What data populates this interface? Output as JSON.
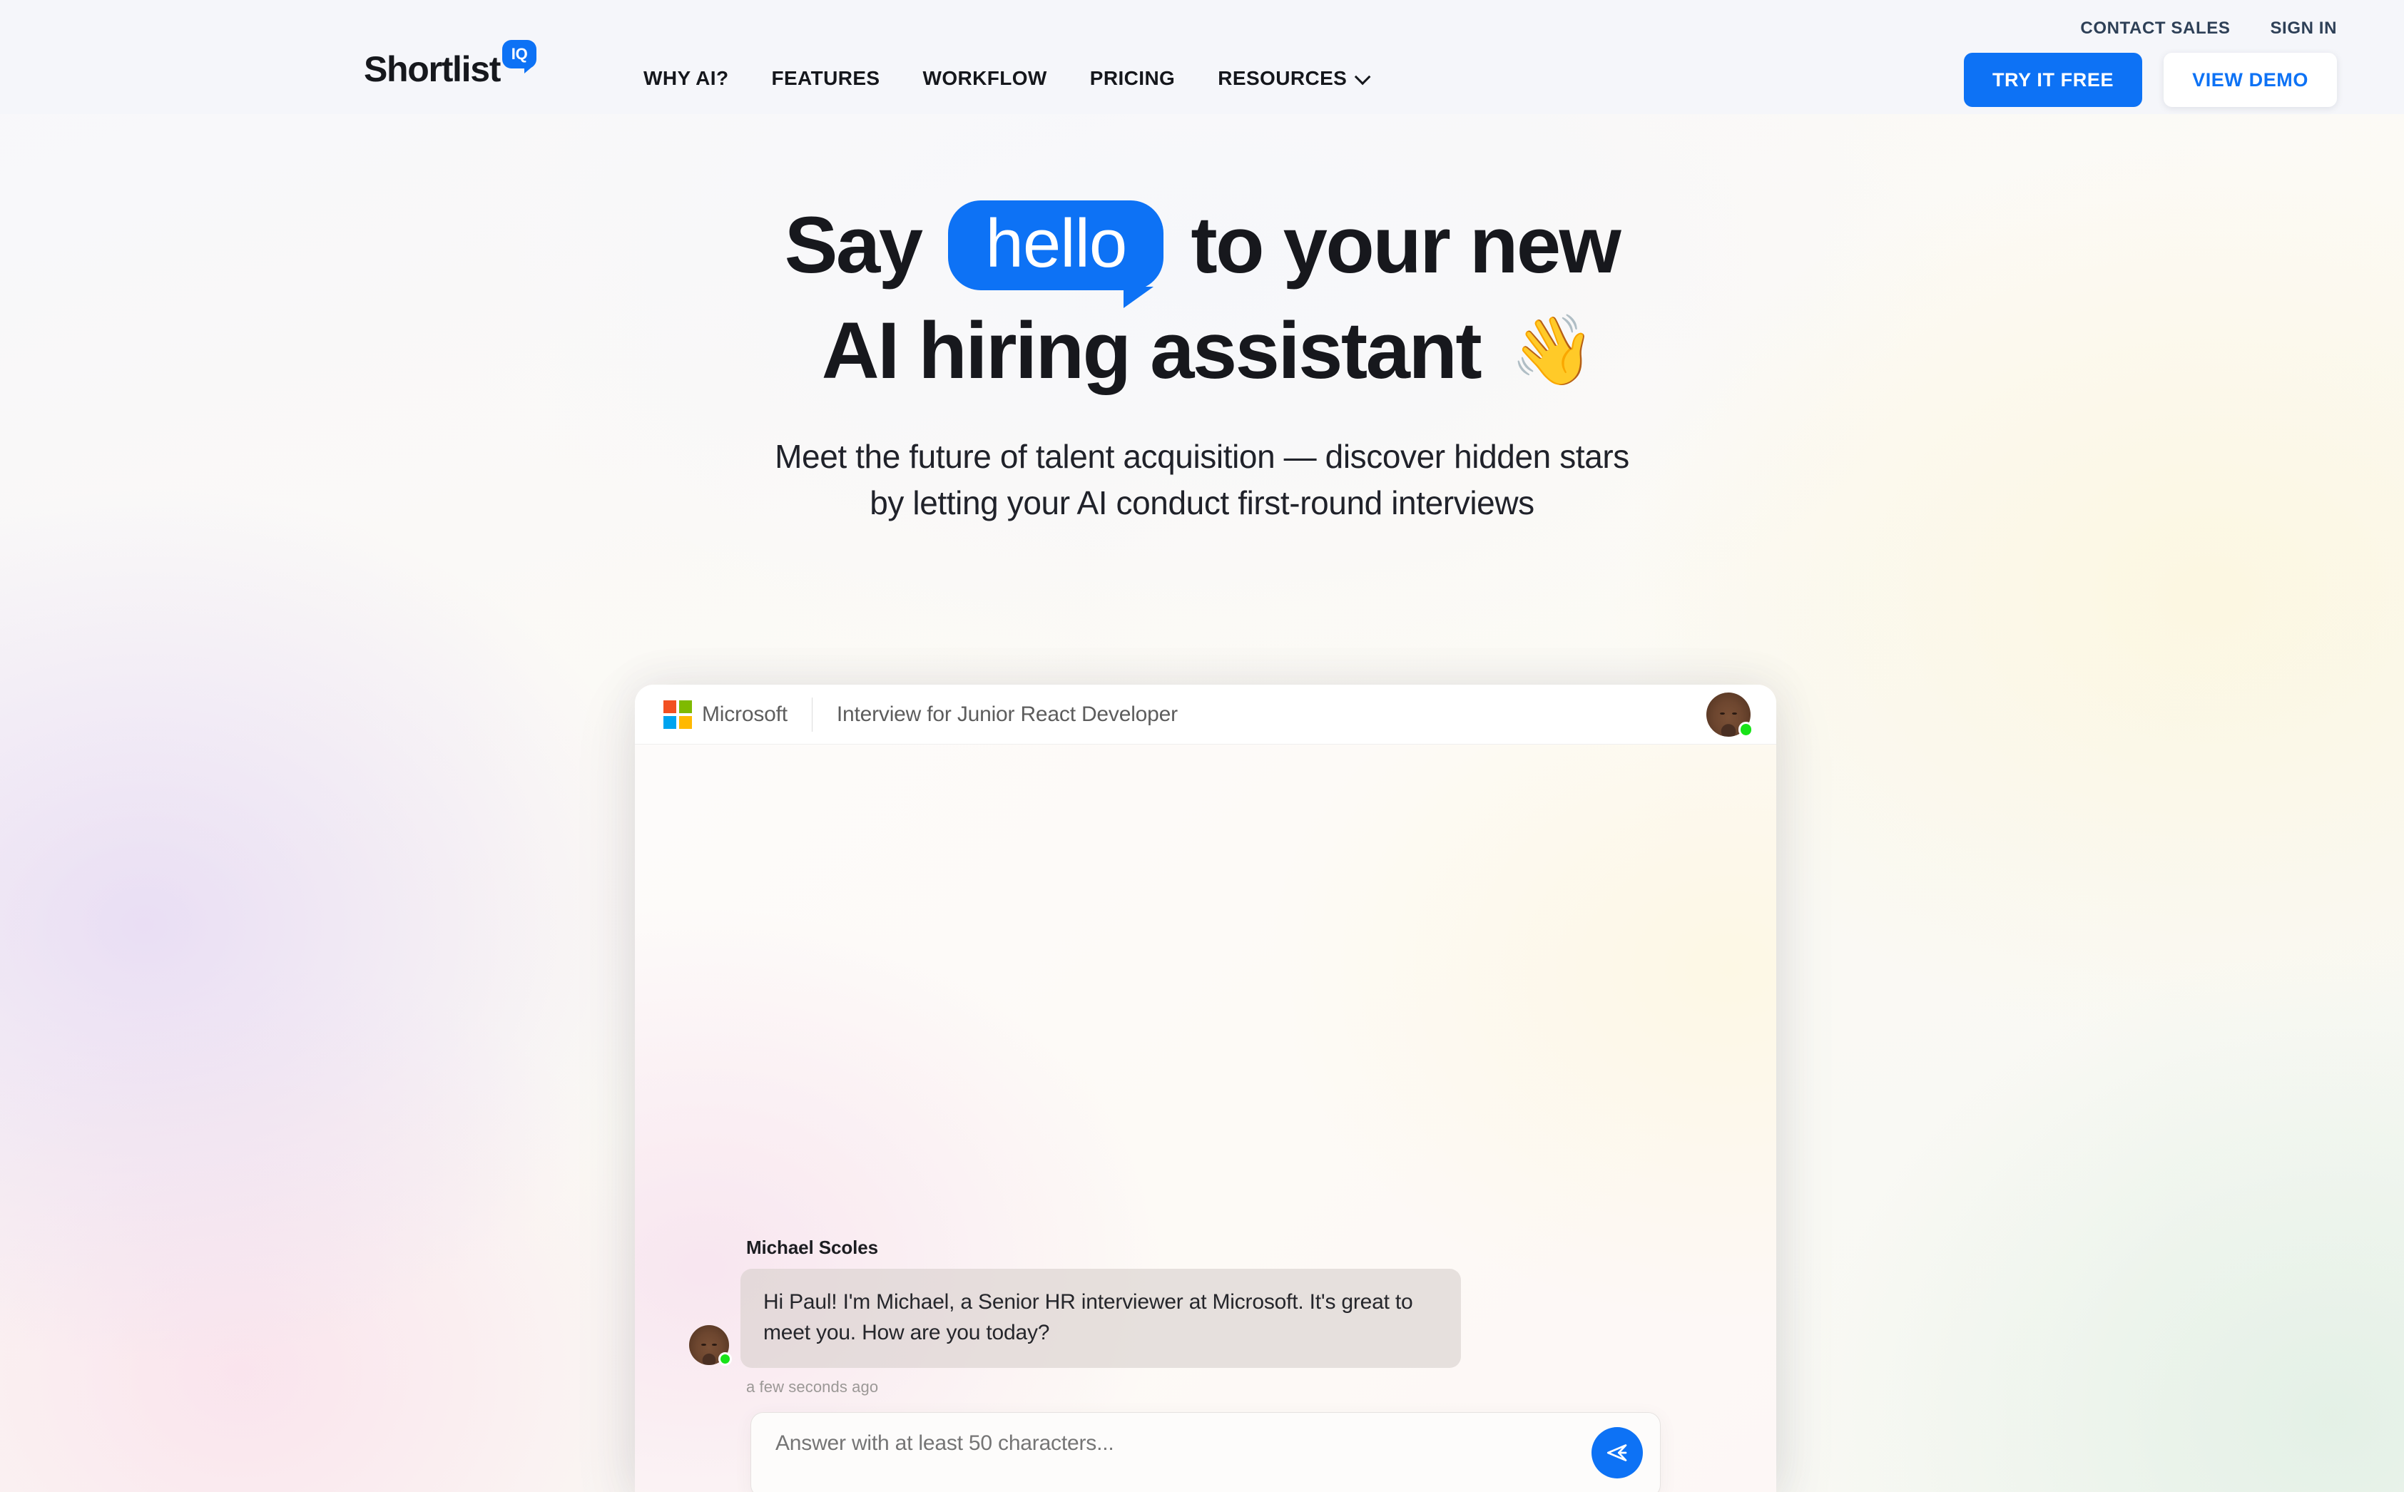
{
  "brand": {
    "name": "Shortlist",
    "badge": "IQ",
    "accent": "#0d72f5"
  },
  "nav": {
    "items": [
      {
        "label": "WHY AI?",
        "has_chevron": false
      },
      {
        "label": "FEATURES",
        "has_chevron": false
      },
      {
        "label": "WORKFLOW",
        "has_chevron": false
      },
      {
        "label": "PRICING",
        "has_chevron": false
      },
      {
        "label": "RESOURCES",
        "has_chevron": true
      }
    ],
    "utility_links": [
      "CONTACT SALES",
      "SIGN IN"
    ],
    "contact_sales": "CONTACT SALES",
    "sign_in": "SIGN IN",
    "cta_primary": "TRY IT FREE",
    "cta_secondary": "VIEW DEMO"
  },
  "hero": {
    "line1_before": "Say",
    "line1_bubble": "hello",
    "line1_after": "to your new",
    "line2": "AI hiring assistant",
    "line2_emoji": "👋",
    "subhead_line1": "Meet the future of talent acquisition — discover hidden stars",
    "subhead_line2": "by letting your AI conduct first-round interviews"
  },
  "interview_card": {
    "company": "Microsoft",
    "company_colors": {
      "top_left": "#F25022",
      "top_right": "#7FBA00",
      "bottom_left": "#00A4EF",
      "bottom_right": "#FFB900"
    },
    "title": "Interview for Junior React Developer",
    "header_status": "online",
    "message": {
      "sender": "Michael Scoles",
      "text": "Hi Paul! I'm Michael, a Senior HR interviewer at Microsoft. It's great to meet you. How are you today?",
      "timestamp": "a few seconds ago",
      "status": "online"
    },
    "composer": {
      "placeholder": "Answer with at least 50 characters...",
      "value": "",
      "send_label": "send-icon"
    }
  }
}
